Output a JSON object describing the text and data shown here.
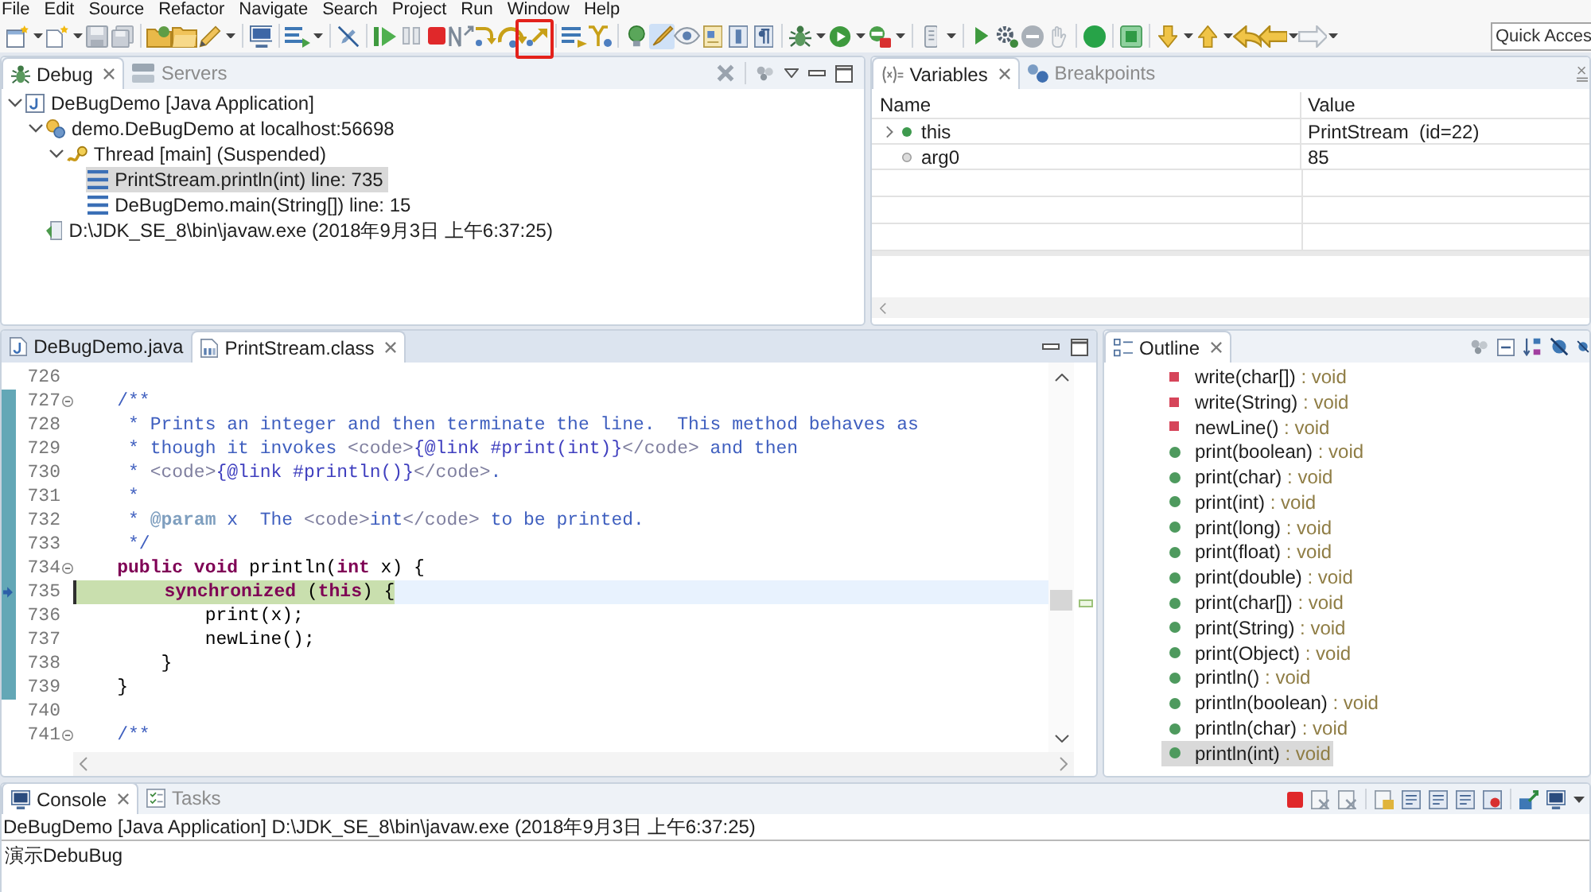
{
  "menu_bar": [
    "File",
    "Edit",
    "Source",
    "Refactor",
    "Navigate",
    "Search",
    "Project",
    "Run",
    "Window",
    "Help"
  ],
  "toolbar": {
    "quick_access": {
      "placeholder": "Quick Acces"
    }
  },
  "debug_view": {
    "tabs": [
      {
        "label": "Debug",
        "kind": "debug",
        "selected": true
      },
      {
        "label": "Servers",
        "kind": "servers",
        "selected": false
      }
    ],
    "tree": [
      {
        "kind": "application",
        "label": "DeBugDemo [Java Application]",
        "expanded": true,
        "selected": false,
        "children": [
          {
            "kind": "vm",
            "label": "demo.DeBugDemo at localhost:56698",
            "expanded": true,
            "selected": false,
            "children": [
              {
                "kind": "thread",
                "label": "Thread [main] (Suspended)",
                "expanded": true,
                "selected": false,
                "children": [
                  {
                    "kind": "frame",
                    "label": "PrintStream.println(int) line: 735",
                    "selected": true
                  },
                  {
                    "kind": "frame",
                    "label": "DeBugDemo.main(String[]) line: 15",
                    "selected": false
                  }
                ]
              }
            ]
          },
          {
            "kind": "process",
            "label": "D:\\JDK_SE_8\\bin\\javaw.exe (2018年9月3日 上午6:37:25)",
            "selected": false
          }
        ]
      }
    ]
  },
  "variables_view": {
    "tabs": [
      {
        "label": "Variables",
        "kind": "variables",
        "selected": true
      },
      {
        "label": "Breakpoints",
        "kind": "breakpoints",
        "selected": false
      }
    ],
    "columns": [
      "Name",
      "Value"
    ],
    "rows": [
      {
        "kind": "object",
        "name": "this",
        "value": "PrintStream  (id=22)",
        "expanded": false
      },
      {
        "kind": "primitive",
        "name": "arg0",
        "value": "85"
      }
    ]
  },
  "editor": {
    "tabs": [
      {
        "label": "DeBugDemo.java",
        "kind": "java",
        "selected": false
      },
      {
        "label": "PrintStream.class",
        "kind": "class",
        "selected": true
      }
    ],
    "lines": [
      {
        "number": "726",
        "fold": false,
        "in_range": false,
        "current": false
      },
      {
        "number": "727",
        "tokens": [
          {
            "kind": "comment",
            "text": "    /**"
          }
        ],
        "fold": true,
        "in_range": true,
        "current": false
      },
      {
        "number": "728",
        "tokens": [
          {
            "kind": "comment",
            "text": "     * Prints an integer and then terminate the line.  This method behaves as"
          }
        ],
        "fold": false,
        "in_range": true,
        "current": false
      },
      {
        "number": "729",
        "tokens": [
          {
            "kind": "comment",
            "text": "     * though it invokes "
          },
          {
            "kind": "tag",
            "text": "<code>"
          },
          {
            "kind": "link",
            "text": "{@link #print(int)}"
          },
          {
            "kind": "tag",
            "text": "</code>"
          },
          {
            "kind": "comment",
            "text": " and then"
          }
        ],
        "fold": false,
        "in_range": true,
        "current": false
      },
      {
        "number": "730",
        "tokens": [
          {
            "kind": "comment",
            "text": "     * "
          },
          {
            "kind": "tag",
            "text": "<code>"
          },
          {
            "kind": "link",
            "text": "{@link #println()}"
          },
          {
            "kind": "tag",
            "text": "</code>"
          },
          {
            "kind": "comment",
            "text": "."
          }
        ],
        "fold": false,
        "in_range": true,
        "current": false
      },
      {
        "number": "731",
        "tokens": [
          {
            "kind": "comment",
            "text": "     *"
          }
        ],
        "fold": false,
        "in_range": true,
        "current": false
      },
      {
        "number": "732",
        "tokens": [
          {
            "kind": "comment",
            "text": "     * "
          },
          {
            "kind": "doctag",
            "text": "@param"
          },
          {
            "kind": "comment",
            "text": " x  The "
          },
          {
            "kind": "tag",
            "text": "<code>"
          },
          {
            "kind": "comment",
            "text": "int"
          },
          {
            "kind": "tag",
            "text": "</code>"
          },
          {
            "kind": "comment",
            "text": " to be printed."
          }
        ],
        "fold": false,
        "in_range": true,
        "current": false
      },
      {
        "number": "733",
        "tokens": [
          {
            "kind": "comment",
            "text": "     */"
          }
        ],
        "fold": false,
        "in_range": true,
        "current": false
      },
      {
        "number": "734",
        "tokens": [
          {
            "kind": "keyword",
            "text": "    public"
          },
          {
            "kind": "keyword",
            "text": " void"
          },
          {
            "kind": "plain",
            "text": " println("
          },
          {
            "kind": "keyword",
            "text": "int"
          },
          {
            "kind": "plain",
            "text": " x) {"
          }
        ],
        "fold": true,
        "in_range": true,
        "current": false
      },
      {
        "number": "735",
        "tokens": [
          {
            "kind": "keyword",
            "text": "        synchronized"
          },
          {
            "kind": "plain",
            "text": " ("
          },
          {
            "kind": "keyword",
            "text": "this"
          },
          {
            "kind": "plain",
            "text": ") {"
          }
        ],
        "fold": false,
        "in_range": true,
        "current": true
      },
      {
        "number": "736",
        "tokens": [
          {
            "kind": "plain",
            "text": "            print(x);"
          }
        ],
        "fold": false,
        "in_range": true,
        "current": false
      },
      {
        "number": "737",
        "tokens": [
          {
            "kind": "plain",
            "text": "            newLine();"
          }
        ],
        "fold": false,
        "in_range": true,
        "current": false
      },
      {
        "number": "738",
        "tokens": [
          {
            "kind": "plain",
            "text": "        }"
          }
        ],
        "fold": false,
        "in_range": true,
        "current": false
      },
      {
        "number": "739",
        "tokens": [
          {
            "kind": "plain",
            "text": "    }"
          }
        ],
        "fold": false,
        "in_range": true,
        "current": false
      },
      {
        "number": "740",
        "fold": false,
        "in_range": false,
        "current": false
      },
      {
        "number": "741",
        "tokens": [
          {
            "kind": "comment",
            "text": "    /**"
          }
        ],
        "fold": true,
        "in_range": false,
        "current": false
      }
    ]
  },
  "outline": {
    "tabs": [
      {
        "label": "Outline",
        "kind": "outline",
        "selected": true
      }
    ],
    "items": [
      {
        "kind": "private",
        "name": "write(char[])",
        "type": ": void",
        "selected": false
      },
      {
        "kind": "private",
        "name": "write(String)",
        "type": ": void",
        "selected": false
      },
      {
        "kind": "private",
        "name": "newLine()",
        "type": ": void",
        "selected": false
      },
      {
        "kind": "public",
        "name": "print(boolean)",
        "type": ": void",
        "selected": false
      },
      {
        "kind": "public",
        "name": "print(char)",
        "type": ": void",
        "selected": false
      },
      {
        "kind": "public",
        "name": "print(int)",
        "type": ": void",
        "selected": false
      },
      {
        "kind": "public",
        "name": "print(long)",
        "type": ": void",
        "selected": false
      },
      {
        "kind": "public",
        "name": "print(float)",
        "type": ": void",
        "selected": false
      },
      {
        "kind": "public",
        "name": "print(double)",
        "type": ": void",
        "selected": false
      },
      {
        "kind": "public",
        "name": "print(char[])",
        "type": ": void",
        "selected": false
      },
      {
        "kind": "public",
        "name": "print(String)",
        "type": ": void",
        "selected": false
      },
      {
        "kind": "public",
        "name": "print(Object)",
        "type": ": void",
        "selected": false
      },
      {
        "kind": "public",
        "name": "println()",
        "type": ": void",
        "selected": false
      },
      {
        "kind": "public",
        "name": "println(boolean)",
        "type": ": void",
        "selected": false
      },
      {
        "kind": "public",
        "name": "println(char)",
        "type": ": void",
        "selected": false
      },
      {
        "kind": "public",
        "name": "println(int)",
        "type": ": void",
        "selected": true
      }
    ]
  },
  "console": {
    "tabs": [
      {
        "label": "Console",
        "kind": "console",
        "selected": true
      },
      {
        "label": "Tasks",
        "kind": "tasks",
        "selected": false
      }
    ],
    "description": "DeBugDemo [Java Application] D:\\JDK_SE_8\\bin\\javaw.exe (2018年9月3日 上午6:37:25)",
    "output": [
      "演示DebuBug"
    ]
  }
}
